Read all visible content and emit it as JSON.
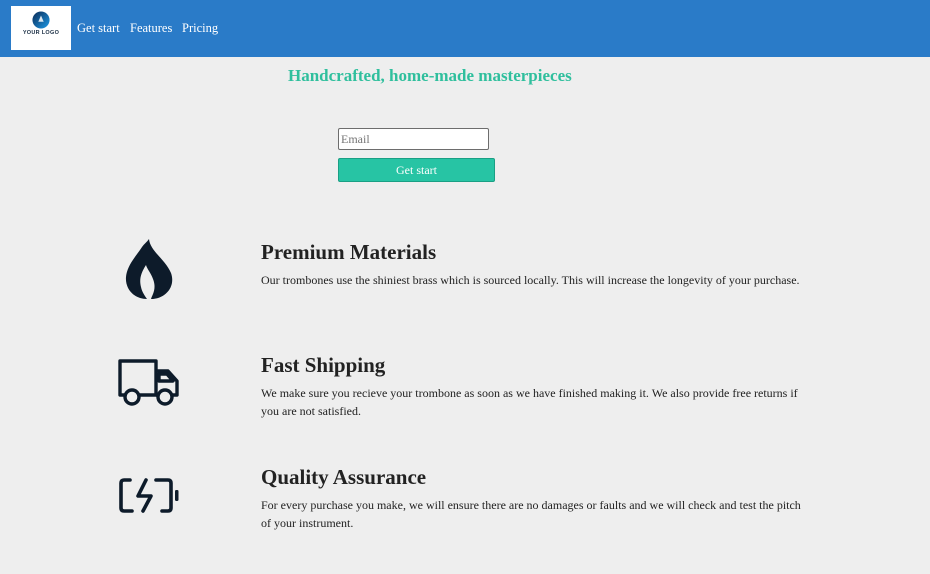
{
  "navbar": {
    "logo": {
      "text": "YOUR LOGO",
      "tagline": ""
    },
    "links": [
      {
        "label": "Get start"
      },
      {
        "label": "Features"
      },
      {
        "label": "Pricing"
      }
    ]
  },
  "hero": {
    "title": "Handcrafted, home-made masterpieces",
    "email_placeholder": "Email",
    "button_label": "Get start"
  },
  "features": [
    {
      "icon": "fire-icon",
      "title": "Premium Materials",
      "description": "Our trombones use the shiniest brass which is sourced locally. This will increase the longevity of your purchase."
    },
    {
      "icon": "truck-icon",
      "title": "Fast Shipping",
      "description": "We make sure you recieve your trombone as soon as we have finished making it. We also provide free returns if you are not satisfied."
    },
    {
      "icon": "battery-charging-icon",
      "title": "Quality Assurance",
      "description": "For every purchase you make, we will ensure there are no damages or faults and we will check and test the pitch of your instrument."
    }
  ],
  "colors": {
    "navbar": "#2a7bc8",
    "accent": "#27c4a4",
    "background": "#eeeeee",
    "icon": "#0d1b2a"
  }
}
